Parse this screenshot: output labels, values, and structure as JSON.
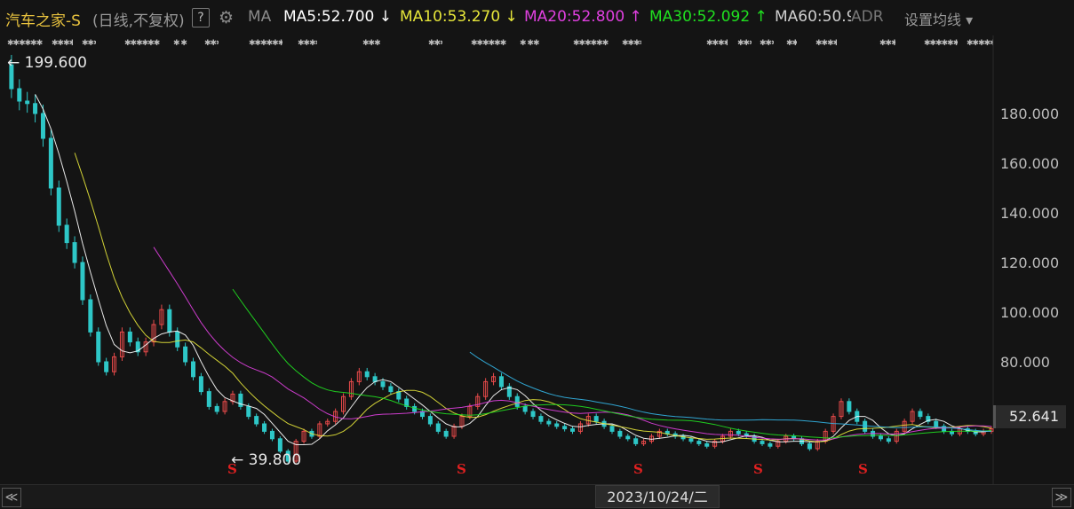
{
  "header": {
    "title": "汽车之家-S",
    "subtitle": "(日线,不复权)",
    "help": "?",
    "ma_label": "MA",
    "ma_items": [
      {
        "text": "MA5:52.700",
        "arrow": "↓",
        "color": "#ffffff"
      },
      {
        "text": "MA10:53.270",
        "arrow": "↓",
        "color": "#e6e63a"
      },
      {
        "text": "MA20:52.800",
        "arrow": "↑",
        "color": "#e040e0"
      },
      {
        "text": "MA30:52.092",
        "arrow": "↑",
        "color": "#20e020"
      },
      {
        "text": "MA60:50.9",
        "arrow": "",
        "color": "#cfcfcf"
      }
    ],
    "adr": "ADR",
    "set_ma": "设置均线",
    "icons": [
      "gear-icon",
      "dropdown-caret-icon"
    ]
  },
  "footer": {
    "date": "2023/10/24/二",
    "left_nav": "≪",
    "right_nav": "≫"
  },
  "chart_data": {
    "type": "line",
    "ylim": [
      40,
      200
    ],
    "yticks": [
      "180.000",
      "160.000",
      "140.000",
      "120.000",
      "100.000",
      "80.000"
    ],
    "last_price": "52.641",
    "max_label": "199.600",
    "min_label": "39.800",
    "s_markers": [
      "S",
      "S",
      "S",
      "S",
      "S"
    ],
    "price_series": [
      199.6,
      190,
      185,
      184,
      180,
      170,
      150,
      135,
      128,
      120,
      105,
      92,
      80,
      76,
      82,
      92,
      88,
      84,
      88,
      95,
      101,
      92,
      86,
      80,
      74,
      68,
      62,
      60,
      64,
      67,
      62,
      58,
      55,
      52,
      49,
      44,
      40,
      48,
      52,
      50,
      55,
      56,
      60,
      66,
      72,
      76,
      74,
      72,
      70,
      68,
      65,
      62,
      60,
      58,
      55,
      52,
      50,
      54,
      58,
      62,
      66,
      72,
      74,
      70,
      66,
      62,
      60,
      58,
      56,
      55,
      54,
      53,
      52,
      55,
      58,
      56,
      54,
      52,
      50,
      49,
      47,
      48,
      50,
      52,
      51,
      50,
      49,
      48,
      47,
      46,
      48,
      50,
      52,
      51,
      50,
      48,
      47,
      46,
      48,
      50,
      49,
      47,
      45,
      48,
      52,
      58,
      64,
      60,
      56,
      52,
      50,
      49,
      48,
      52,
      56,
      60,
      58,
      56,
      54,
      52,
      51,
      53,
      52,
      51,
      52,
      53
    ]
  }
}
